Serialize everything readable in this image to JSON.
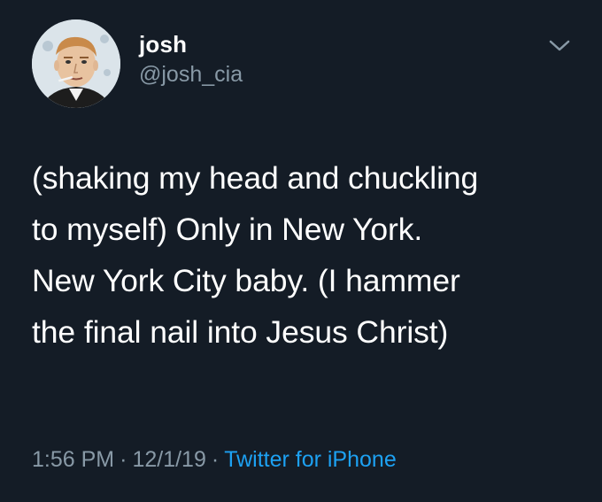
{
  "user": {
    "display_name": "josh",
    "handle": "@josh_cia"
  },
  "icons": {
    "menu": "chevron-down-icon"
  },
  "tweet": {
    "text": "(shaking my head and chuckling\nto myself) Only in New York.\nNew York City baby. (I hammer\nthe final nail into Jesus Christ)"
  },
  "meta": {
    "time": "1:56 PM",
    "separator": "·",
    "date": "12/1/19",
    "source": "Twitter for iPhone"
  },
  "colors": {
    "background": "#141c26",
    "primary_text": "#ffffff",
    "secondary_text": "#8899a6",
    "link": "#1da1f2"
  }
}
